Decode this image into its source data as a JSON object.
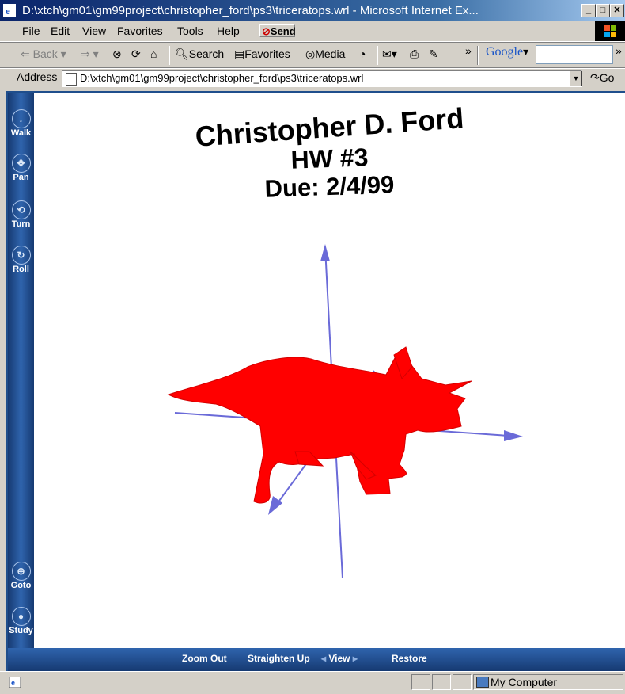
{
  "window": {
    "title": "D:\\xtch\\gm01\\gm99project\\christopher_ford\\ps3\\triceratops.wrl - Microsoft Internet Ex...",
    "minimize": "_",
    "maximize": "□",
    "close": "✕"
  },
  "menu": {
    "file": "File",
    "edit": "Edit",
    "view": "View",
    "favorites": "Favorites",
    "tools": "Tools",
    "help": "Help",
    "send": "Send"
  },
  "toolbar": {
    "back": "Back",
    "search": "Search",
    "favorites": "Favorites",
    "media": "Media",
    "more": "»",
    "google": "Google",
    "more2": "»"
  },
  "address": {
    "label": "Address",
    "url": "D:\\xtch\\gm01\\gm99project\\christopher_ford\\ps3\\triceratops.wrl",
    "go": "Go"
  },
  "vrml": {
    "nav": {
      "walk": "Walk",
      "pan": "Pan",
      "turn": "Turn",
      "roll": "Roll",
      "goto": "Goto",
      "study": "Study"
    },
    "bottom": {
      "zoom_out": "Zoom Out",
      "straighten_up": "Straighten Up",
      "view": "View",
      "restore": "Restore"
    },
    "scene": {
      "line1": "Christopher D. Ford",
      "line2": "HW #3",
      "line3": "Due: 2/4/99"
    },
    "colors": {
      "model": "#ff0000",
      "axes": "#6a6ad8"
    }
  },
  "status": {
    "zone": "My Computer"
  }
}
